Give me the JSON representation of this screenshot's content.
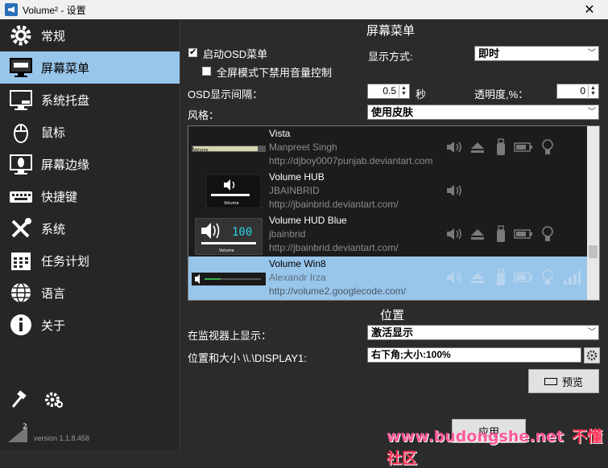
{
  "window": {
    "title": "Volume² - 设置",
    "close_label": "✕"
  },
  "sidebar": {
    "items": [
      {
        "label": "常规",
        "icon": "gear-icon"
      },
      {
        "label": "屏幕菜单",
        "icon": "monitor-icon",
        "active": true
      },
      {
        "label": "系统托盘",
        "icon": "tray-icon"
      },
      {
        "label": "鼠标",
        "icon": "mouse-icon"
      },
      {
        "label": "屏幕边缘",
        "icon": "screen-edge-icon"
      },
      {
        "label": "快捷键",
        "icon": "keyboard-icon"
      },
      {
        "label": "系统",
        "icon": "tools-icon"
      },
      {
        "label": "任务计划",
        "icon": "calendar-icon"
      },
      {
        "label": "语言",
        "icon": "globe-icon"
      },
      {
        "label": "关于",
        "icon": "info-icon"
      }
    ],
    "footer_icons": [
      "hammer-icon",
      "settings-gear-icon"
    ],
    "version": "version 1.1.8.458"
  },
  "osd": {
    "section_title": "屏幕菜单",
    "enable_label": "启动OSD菜单",
    "enable_checked": true,
    "fullscreen_label": "全屏模式下禁用音量控制",
    "fullscreen_checked": false,
    "display_mode_label": "显示方式:",
    "display_mode_value": "即时",
    "interval_label": "OSD显示间隔：",
    "interval_value": "0.5",
    "interval_unit": "秒",
    "transparency_label": "透明度,%：",
    "transparency_value": "0",
    "style_label": "风格：",
    "style_value": "使用皮肤"
  },
  "skins": [
    {
      "name": "Vista",
      "author": "Manpreet Singh",
      "url": "http://djboy0007punjab.deviantart.com",
      "preview": "Volume"
    },
    {
      "name": "Volume HUB",
      "author": "JBAINBRID",
      "url": "http://jbainbrid.deviantart.com/",
      "preview": "Volume"
    },
    {
      "name": "Volume HUD Blue",
      "author": "jbainbrid",
      "url": "http://jbainbrid.deviantart.com/",
      "preview": "Volume",
      "digits": "100"
    },
    {
      "name": "Volume Win8",
      "author": "Alexandr Irza",
      "url": "http://volume2.googlecode.com/",
      "selected": true
    }
  ],
  "position": {
    "section_title": "位置",
    "monitor_label": "在监视器上显示：",
    "monitor_value": "激活显示",
    "size_label": "位置和大小 \\\\.\\DISPLAY1:",
    "size_value": "右下角;大小:100%",
    "preview_button": "预览"
  },
  "bottom": {
    "apply_button": "应用"
  },
  "watermark": {
    "site": "www.budongshe.net",
    "brand": "不懂社区"
  },
  "colors": {
    "accent": "#98c5ea",
    "background": "#2b2b2b"
  }
}
